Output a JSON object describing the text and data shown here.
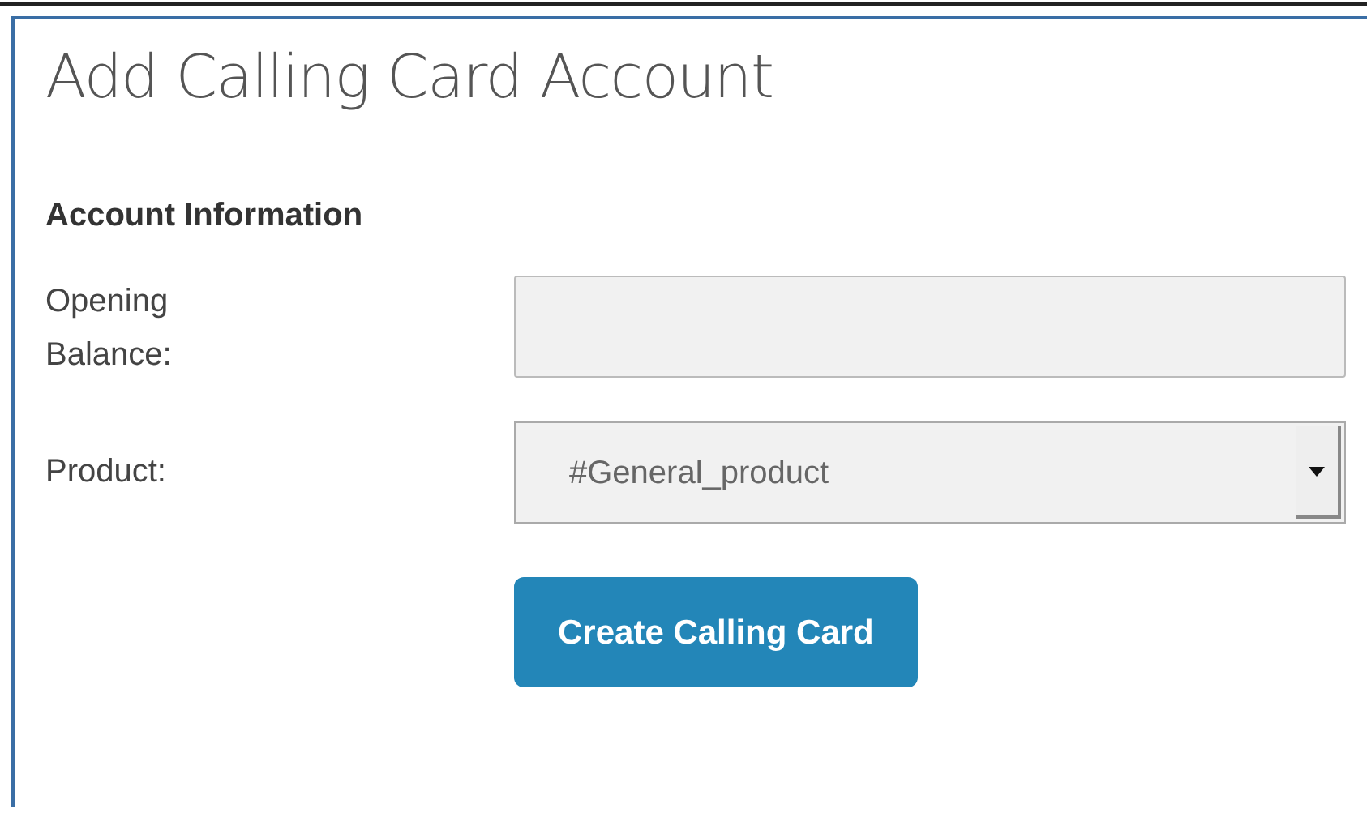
{
  "title": "Add Calling Card Account",
  "section": "Account Information",
  "fields": [
    {
      "kind": "text",
      "label": "Opening Balance:"
    },
    {
      "kind": "select",
      "label": "Product:",
      "value": "#General_product"
    }
  ],
  "button": "Create Calling Card"
}
